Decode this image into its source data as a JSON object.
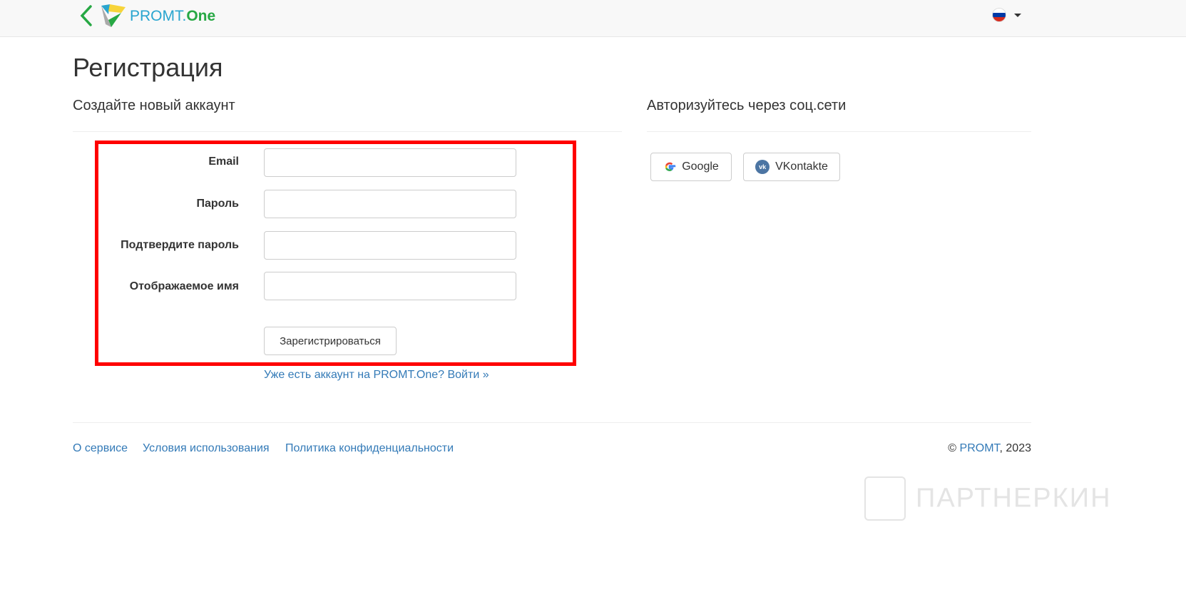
{
  "header": {
    "brand_main": "PROMT.",
    "brand_accent": "One",
    "language": "ru"
  },
  "page": {
    "title": "Регистрация",
    "subtitle": "Создайте новый аккаунт",
    "social_title": "Авторизуйтесь через соц.сети"
  },
  "form": {
    "email_label": "Email",
    "password_label": "Пароль",
    "confirm_label": "Подтвердите пароль",
    "display_name_label": "Отображаемое имя",
    "email_value": "",
    "password_value": "",
    "confirm_value": "",
    "display_name_value": "",
    "submit_label": "Зарегистрироваться",
    "login_link": "Уже есть аккаунт на PROMT.One? Войти »"
  },
  "social": {
    "google": "Google",
    "vk": "VKontakte"
  },
  "footer": {
    "links": [
      "О сервисе",
      "Условия использования",
      "Политика конфиденциальности"
    ],
    "copyright_symbol": "©",
    "company": "PROMT",
    "year": ", 2023"
  },
  "watermark": "ПАРТНЕРКИН",
  "colors": {
    "accent": "#337ab7",
    "highlight": "#ff0000",
    "brand_blue": "#29a5cf",
    "brand_green": "#27a844"
  }
}
